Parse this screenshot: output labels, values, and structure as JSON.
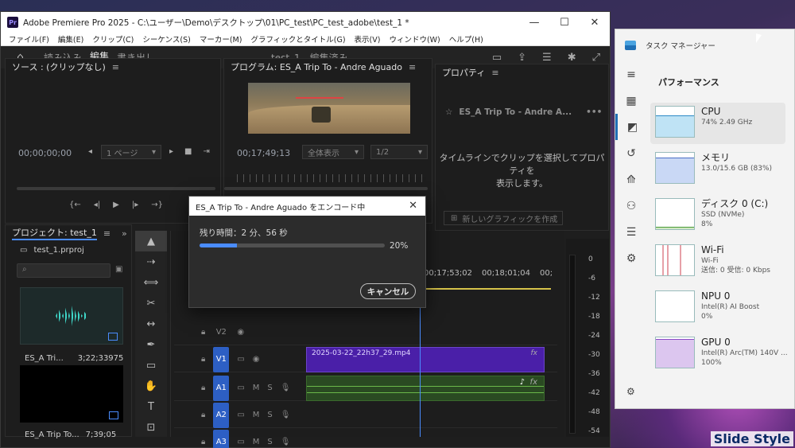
{
  "premiere": {
    "title": "Adobe Premiere Pro 2025 - C:\\ユーザー\\Demo\\デスクトップ\\01\\PC_test\\PC_test_adobe\\test_1 *",
    "menus": [
      "ファイル(F)",
      "編集(E)",
      "クリップ(C)",
      "シーケンス(S)",
      "マーカー(M)",
      "グラフィックとタイトル(G)",
      "表示(V)",
      "ウィンドウ(W)",
      "ヘルプ(H)"
    ],
    "workspace_tabs": [
      "読み込み",
      "編集",
      "書き出し"
    ],
    "project_state": "test_1 - 編集済み",
    "source_panel": {
      "title": "ソース : (クリップなし)",
      "timecode": "00;00;00;00",
      "page_dropdown": "1 ページ"
    },
    "program_panel": {
      "title": "プログラム: ES_A Trip To - Andre Aguado",
      "timecode": "00;17;49;13",
      "fit_dropdown": "全体表示",
      "res_dropdown": "1/2"
    },
    "properties_panel": {
      "title": "プロパティ",
      "item": "ES_A Trip To - Andre A...",
      "message_line1": "タイムラインでクリップを選択してプロパティを",
      "message_line2": "表示します。",
      "new_graphic": "新しいグラフィックを作成"
    },
    "project_panel": {
      "title": "プロジェクト: test_1",
      "file": "test_1.prproj",
      "clips": [
        {
          "name": "ES_A Tri...",
          "duration": "3;22;33975"
        },
        {
          "name": "ES_A Trip To...",
          "duration": "7;39;05"
        }
      ]
    },
    "timeline": {
      "timecodes": [
        "00;17;53;02",
        "00;18;01;04",
        "00;"
      ],
      "tracks": [
        {
          "name": "V2"
        },
        {
          "name": "V1"
        },
        {
          "name": "A1",
          "m": "M",
          "s": "S"
        },
        {
          "name": "A2",
          "m": "M",
          "s": "S"
        },
        {
          "name": "A3",
          "m": "M",
          "s": "S"
        }
      ],
      "v1_clip": "2025-03-22_22h37_29.mp4",
      "fx_label": "fx"
    },
    "meter_labels": [
      "0",
      "-6",
      "-12",
      "-18",
      "-24",
      "-30",
      "-36",
      "-42",
      "-48",
      "-54"
    ]
  },
  "dialog": {
    "title": "ES_A Trip To - Andre Aguado をエンコード中",
    "remaining": "残り時間：2 分、56 秒",
    "progress_percent": 20,
    "progress_label": "20%",
    "cancel": "キャンセル"
  },
  "task_manager": {
    "title": "タスク マネージャー",
    "heading": "パフォーマンス",
    "items": [
      {
        "name": "CPU",
        "line1": "74%  2.49 GHz",
        "line2": ""
      },
      {
        "name": "メモリ",
        "line1": "13.0/15.6 GB (83%)",
        "line2": ""
      },
      {
        "name": "ディスク 0 (C:)",
        "line1": "SSD (NVMe)",
        "line2": "8%"
      },
      {
        "name": "Wi-Fi",
        "line1": "Wi-Fi",
        "line2": "送信: 0 受信: 0 Kbps"
      },
      {
        "name": "NPU 0",
        "line1": "Intel(R) AI Boost",
        "line2": "0%"
      },
      {
        "name": "GPU 0",
        "line1": "Intel(R) Arc(TM) 140V ...",
        "line2": "100%"
      }
    ]
  },
  "watermark": "Slide Style"
}
